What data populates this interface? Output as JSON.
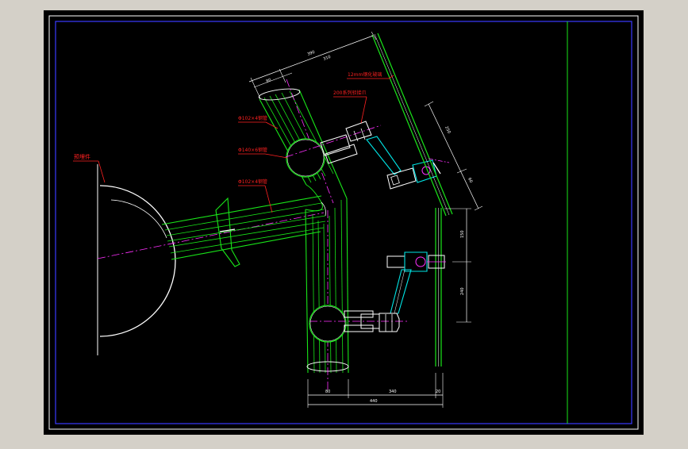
{
  "app": {
    "background_color": "#d4d0c8",
    "canvas_color": "#000000",
    "frame_color": "#ffffff",
    "inner_border_color": "#2b2bff"
  },
  "drawing": {
    "palette": {
      "green": "#19e619",
      "cyan": "#00e5e5",
      "red": "#ff2020",
      "magenta": "#ff30ff",
      "white": "#ffffff",
      "yellow": "#e8e820",
      "blue": "#3a3aff"
    },
    "annotations": {
      "wall": "预埋件",
      "tube_top": "Φ102×4钢管",
      "sphere": "Φ140×6钢管",
      "tube_left": "Φ102×4钢管",
      "glass": "12mm钢化玻璃",
      "spider": "200系列驳接爪"
    },
    "dimensions": {
      "top_total": "390",
      "top_part_a": "80",
      "top_part_b": "310",
      "slant_a": "250",
      "slant_b": "60",
      "right_upper": "150",
      "right_lower": "240",
      "bottom_a": "80",
      "bottom_b": "340",
      "bottom_c": "20",
      "bottom_total": "440"
    }
  }
}
